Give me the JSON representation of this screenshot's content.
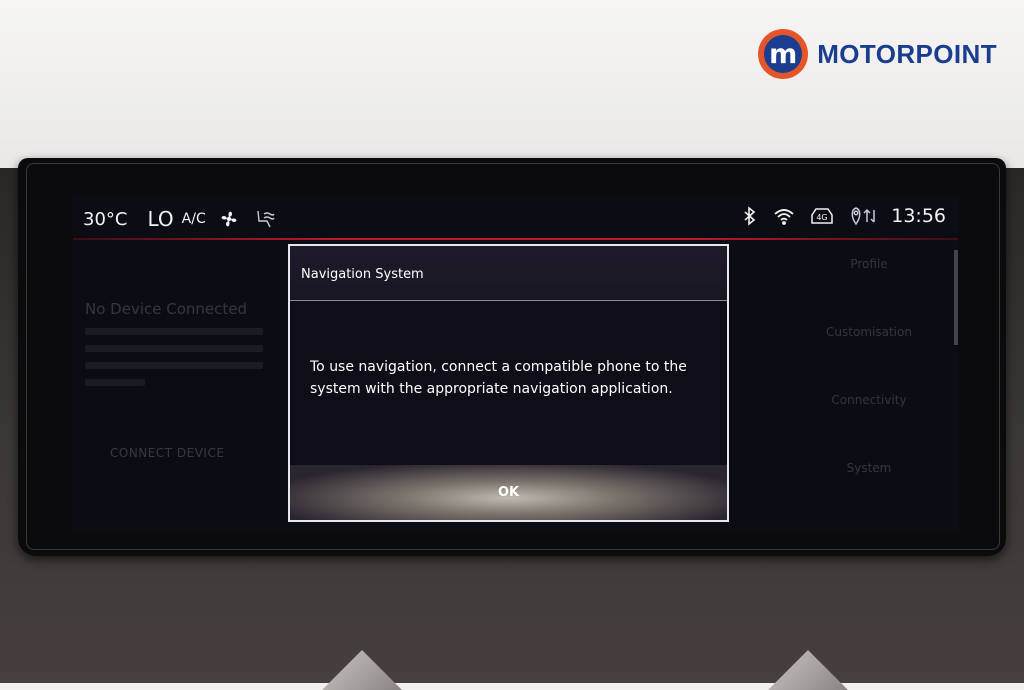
{
  "brand": {
    "name": "MOTORPOINT",
    "mark": "m",
    "colors": {
      "ring": "#e4552a",
      "fill": "#1b3d8f"
    }
  },
  "status_bar": {
    "temperature": "30°C",
    "fan_level": "LO",
    "ac": "A/C",
    "icons": [
      "fan-icon",
      "seat-airflow-icon",
      "bluetooth-icon",
      "wifi-icon",
      "4g-icon",
      "location-sync-icon"
    ],
    "network_badge": "4G",
    "clock": "13:56",
    "accent_color": "#c01a2a"
  },
  "background": {
    "left_heading": "No Device Connected",
    "left_button": "CONNECT DEVICE",
    "right_menu": [
      "Profile",
      "Customisation",
      "Connectivity",
      "System"
    ]
  },
  "dialog": {
    "title": "Navigation System",
    "message": "To use navigation, connect a compatible phone to the system with the appropriate navigation application.",
    "ok_label": "OK"
  }
}
